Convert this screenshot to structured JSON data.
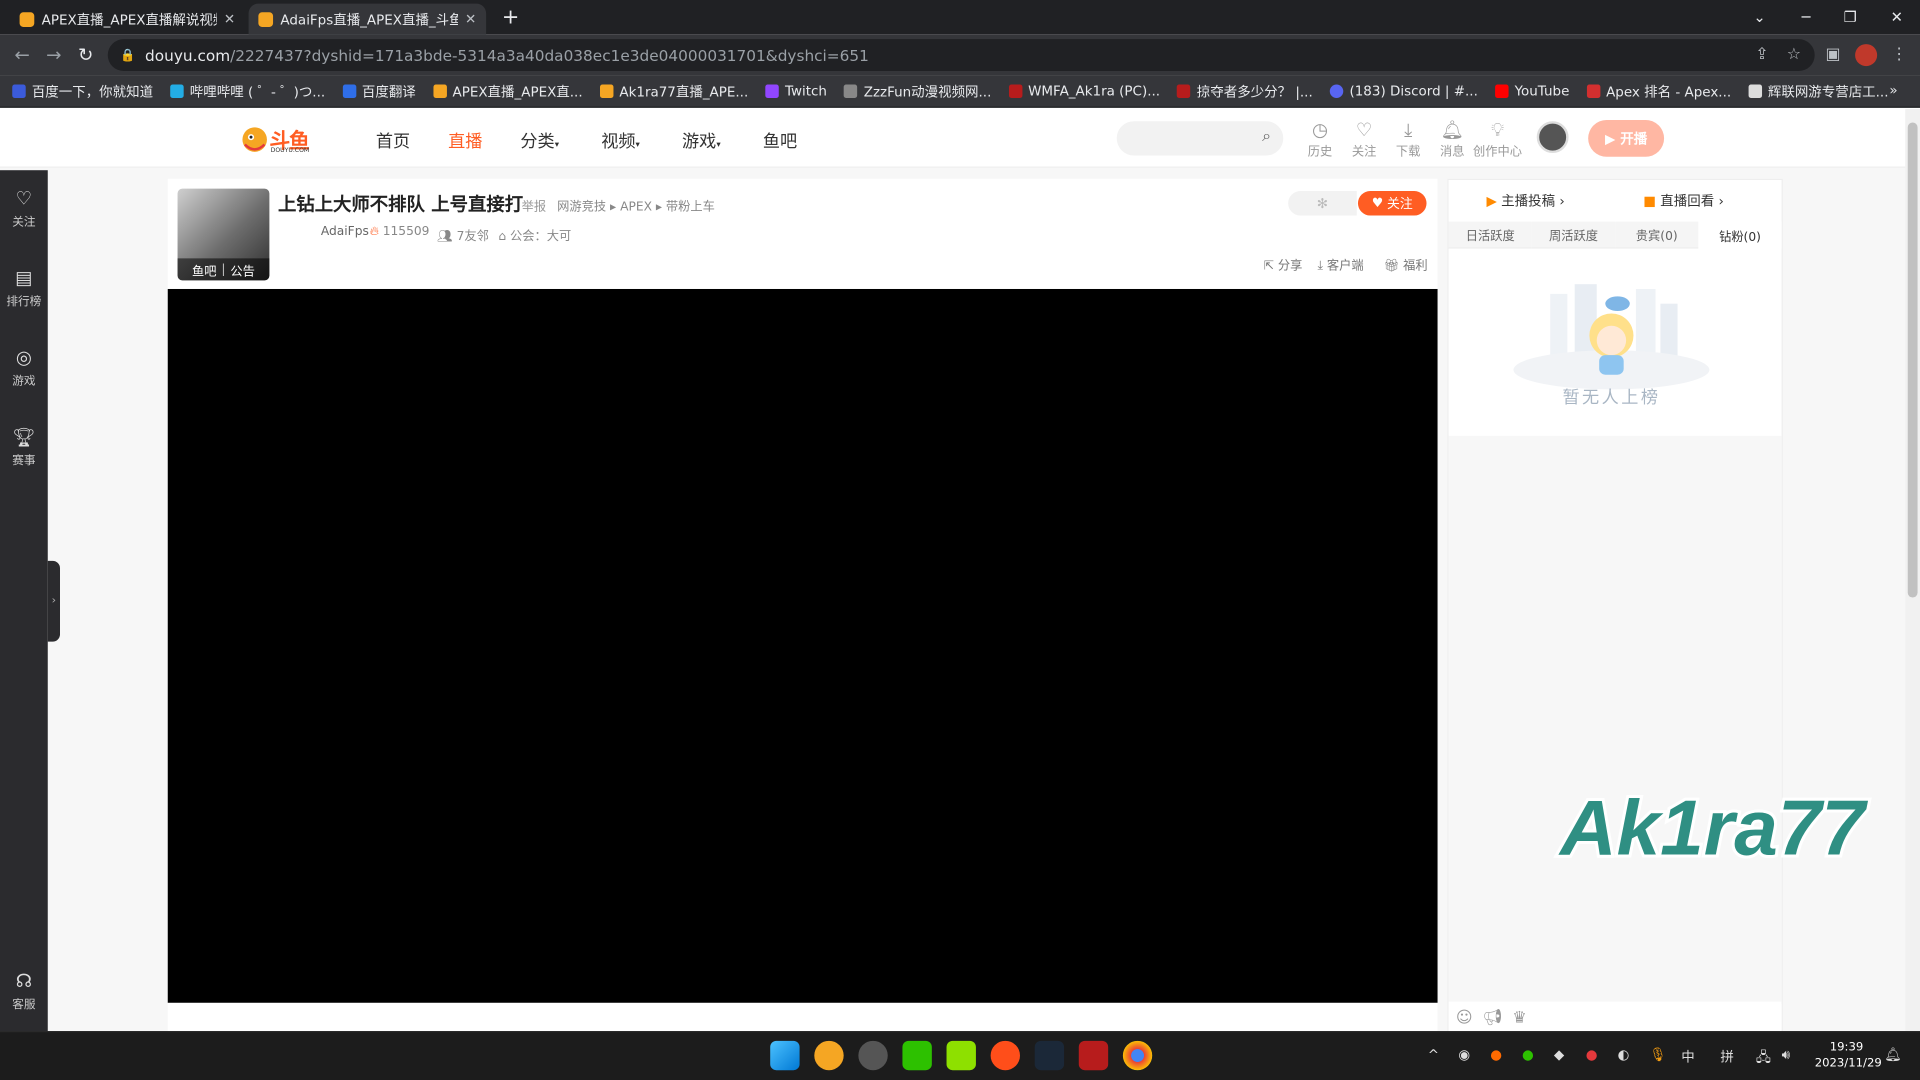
{
  "browser": {
    "tabs": [
      {
        "title": "APEX直播_APEX直播解说视频_",
        "active": false
      },
      {
        "title": "AdaiFps直播_APEX直播_斗鱼直",
        "active": true
      }
    ],
    "url_host": "douyu.com",
    "url_path": "/2227437?dyshid=171a3bde-5314a3a40da038ec1e3de04000031701&dyshci=651",
    "bookmarks": [
      "百度一下，你就知道",
      "哔哩哔哩 ( ゜- ゜)つ...",
      "百度翻译",
      "APEX直播_APEX直...",
      "Ak1ra77直播_APE...",
      "Twitch",
      "ZzzFun动漫视频网...",
      "WMFA_Ak1ra (PC)...",
      "掠夺者多少分？ |...",
      "(183) Discord | #...",
      "YouTube",
      "Apex 排名 - Apex...",
      "辉联网游专营店工..."
    ]
  },
  "site": {
    "logo_text": "斗鱼",
    "logo_sub": "DOUYU.COM",
    "nav": [
      "首页",
      "直播",
      "分类",
      "视频",
      "游戏",
      "鱼吧"
    ],
    "header_icons": [
      "历史",
      "关注",
      "下载",
      "消息",
      "创作中心"
    ],
    "start_button": "开播"
  },
  "rail": {
    "items": [
      "关注",
      "排行榜",
      "游戏",
      "赛事"
    ],
    "bottom": "客服"
  },
  "room": {
    "title": "上钻上大师不排队 上号直接打",
    "report": "举报",
    "breadcrumb": [
      "网游竞技",
      "APEX",
      "带粉上车"
    ],
    "anchor": "AdaiFps",
    "heat": "115509",
    "fans": "7友邻",
    "guild": "公会：大可",
    "pic_labels": [
      "鱼吧",
      "公告"
    ],
    "follow": "关注",
    "actions": [
      "分享",
      "客户端",
      "福利"
    ]
  },
  "panel": {
    "links": [
      "主播投稿",
      "直播回看"
    ],
    "tabs": [
      "日活跃度",
      "周活跃度",
      "贵宾(0)",
      "钻粉(0)"
    ],
    "empty_text": "暂无人上榜"
  },
  "watermark": "Ak1ra77",
  "taskbar": {
    "tray_ime": [
      "中",
      "拼"
    ],
    "time": "19:39",
    "date": "2023/11/29"
  }
}
